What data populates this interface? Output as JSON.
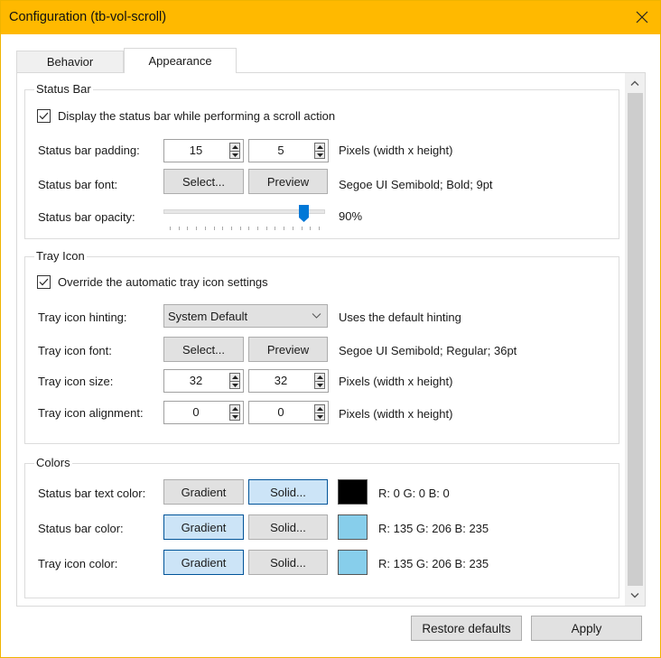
{
  "window": {
    "title": "Configuration (tb-vol-scroll)",
    "close_icon": "close-icon"
  },
  "tabs": [
    {
      "label": "Behavior",
      "selected": false
    },
    {
      "label": "Appearance",
      "selected": true
    }
  ],
  "status_bar": {
    "group_label": "Status Bar",
    "display_checkbox": {
      "label": "Display the status bar while performing a scroll action",
      "checked": true
    },
    "padding": {
      "label": "Status bar padding:",
      "width": "15",
      "height": "5",
      "unit_label": "Pixels (width x height)"
    },
    "font": {
      "label": "Status bar font:",
      "select_label": "Select...",
      "preview_label": "Preview",
      "value": "Segoe UI Semibold; Bold; 9pt"
    },
    "opacity": {
      "label": "Status bar opacity:",
      "value_text": "90%",
      "value_percent": 90,
      "tick_count": 18
    }
  },
  "tray_icon": {
    "group_label": "Tray Icon",
    "override_checkbox": {
      "label": "Override the automatic tray icon settings",
      "checked": true
    },
    "hinting": {
      "label": "Tray icon hinting:",
      "selected": "System Default",
      "description": "Uses the default hinting"
    },
    "font": {
      "label": "Tray icon font:",
      "select_label": "Select...",
      "preview_label": "Preview",
      "value": "Segoe UI Semibold; Regular; 36pt"
    },
    "size": {
      "label": "Tray icon size:",
      "width": "32",
      "height": "32",
      "unit_label": "Pixels (width x height)"
    },
    "alignment": {
      "label": "Tray icon alignment:",
      "x": "0",
      "y": "0",
      "unit_label": "Pixels (width x height)"
    }
  },
  "colors": {
    "group_label": "Colors",
    "rows": [
      {
        "label": "Status bar text color:",
        "gradient_label": "Gradient",
        "solid_label": "Solid...",
        "mode": "solid",
        "swatch": "#000000",
        "value": "R: 0 G: 0 B: 0"
      },
      {
        "label": "Status bar color:",
        "gradient_label": "Gradient",
        "solid_label": "Solid...",
        "mode": "gradient",
        "swatch": "#87ceeb",
        "value": "R: 135 G: 206 B: 235"
      },
      {
        "label": "Tray icon color:",
        "gradient_label": "Gradient",
        "solid_label": "Solid...",
        "mode": "gradient",
        "swatch": "#87ceeb",
        "value": "R: 135 G: 206 B: 235"
      }
    ]
  },
  "footer": {
    "restore_label": "Restore defaults",
    "apply_label": "Apply"
  },
  "theme": {
    "titlebar_color": "#ffb900",
    "accent": "#0078d7",
    "selected_button_bg": "#cce4f7",
    "selected_button_border": "#005499"
  }
}
